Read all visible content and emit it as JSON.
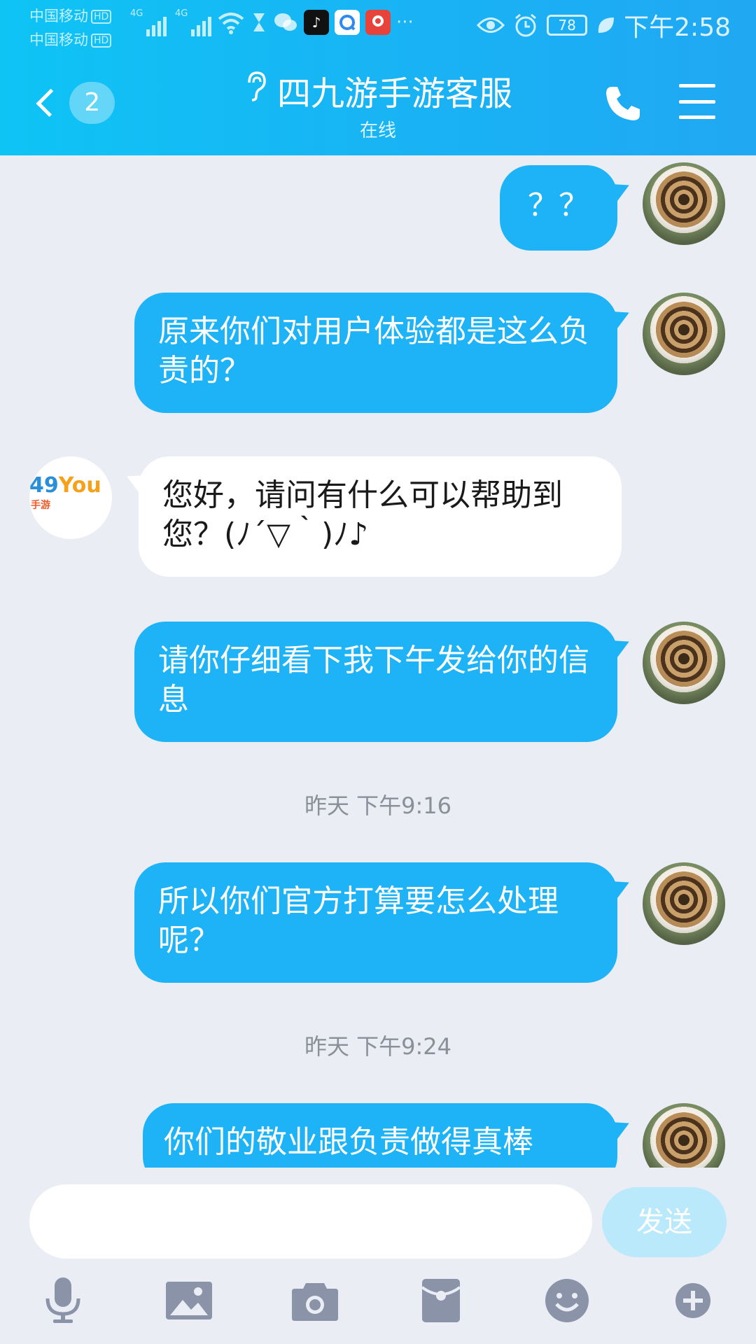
{
  "status_bar": {
    "carrier1": "中国移动",
    "carrier2": "中国移动",
    "hd_label": "HD",
    "network1": "4G",
    "network2": "4G",
    "more": "···",
    "battery": "78",
    "time": "下午2:58"
  },
  "header": {
    "unread_count": "2",
    "title": "四九游手游客服",
    "subtitle": "在线",
    "accent_color": "#12B7F5"
  },
  "messages": [
    {
      "from": "me",
      "text": "？？"
    },
    {
      "from": "me",
      "text": "原来你们对用户体验都是这么负责的？"
    },
    {
      "from": "them",
      "text": "您好，请问有什么可以帮助到您？(ﾉ´▽｀)ﾉ♪"
    },
    {
      "from": "me",
      "text": "请你仔细看下我下午发给你的信息"
    },
    {
      "type": "time",
      "text": "昨天 下午9:16"
    },
    {
      "from": "me",
      "text": "所以你们官方打算要怎么处理呢？"
    },
    {
      "type": "time",
      "text": "昨天 下午9:24"
    },
    {
      "from": "me",
      "text": "你们的敬业跟负责做得真棒"
    }
  ],
  "them_avatar": {
    "text_49": "49",
    "text_you": "You",
    "text_shou": "手游"
  },
  "input": {
    "placeholder": "",
    "send_label": "发送"
  },
  "toolbar": {
    "icons": [
      "microphone-icon",
      "image-icon",
      "camera-icon",
      "red-packet-icon",
      "emoji-icon",
      "plus-icon"
    ]
  }
}
